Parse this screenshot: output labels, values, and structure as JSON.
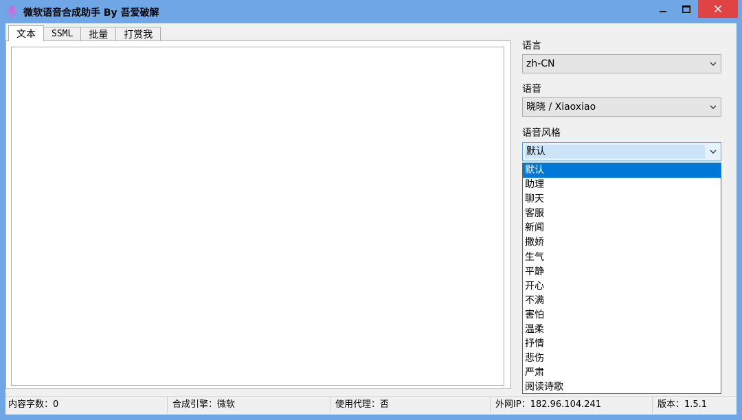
{
  "window": {
    "title": "微软语音合成助手 By 吾爱破解"
  },
  "tabs": [
    {
      "label": "文本"
    },
    {
      "label": "SSML"
    },
    {
      "label": "批量"
    },
    {
      "label": "打赏我"
    }
  ],
  "editor": {
    "value": ""
  },
  "language": {
    "label": "语言",
    "value": "zh-CN"
  },
  "voice": {
    "label": "语音",
    "value": "晓晓 / Xiaoxiao"
  },
  "style": {
    "label": "语音风格",
    "value": "默认",
    "options": [
      "默认",
      "助理",
      "聊天",
      "客服",
      "新闻",
      "撒娇",
      "生气",
      "平静",
      "开心",
      "不满",
      "害怕",
      "温柔",
      "抒情",
      "悲伤",
      "严肃",
      "阅读诗歌"
    ]
  },
  "status": {
    "char_count": "内容字数：0",
    "engine": "合成引擎：微软",
    "proxy": "使用代理：否",
    "ip": "外网IP：182.96.104.241",
    "version": "版本：1.5.1"
  },
  "colors": {
    "titlebar": "#6fa6e6",
    "close_button": "#e04343",
    "selection": "#0078d7"
  },
  "icons": {
    "app": "microphone-icon",
    "minimize": "minimize-icon",
    "maximize": "maximize-icon",
    "close": "close-icon",
    "dropdown": "chevron-down-icon"
  }
}
